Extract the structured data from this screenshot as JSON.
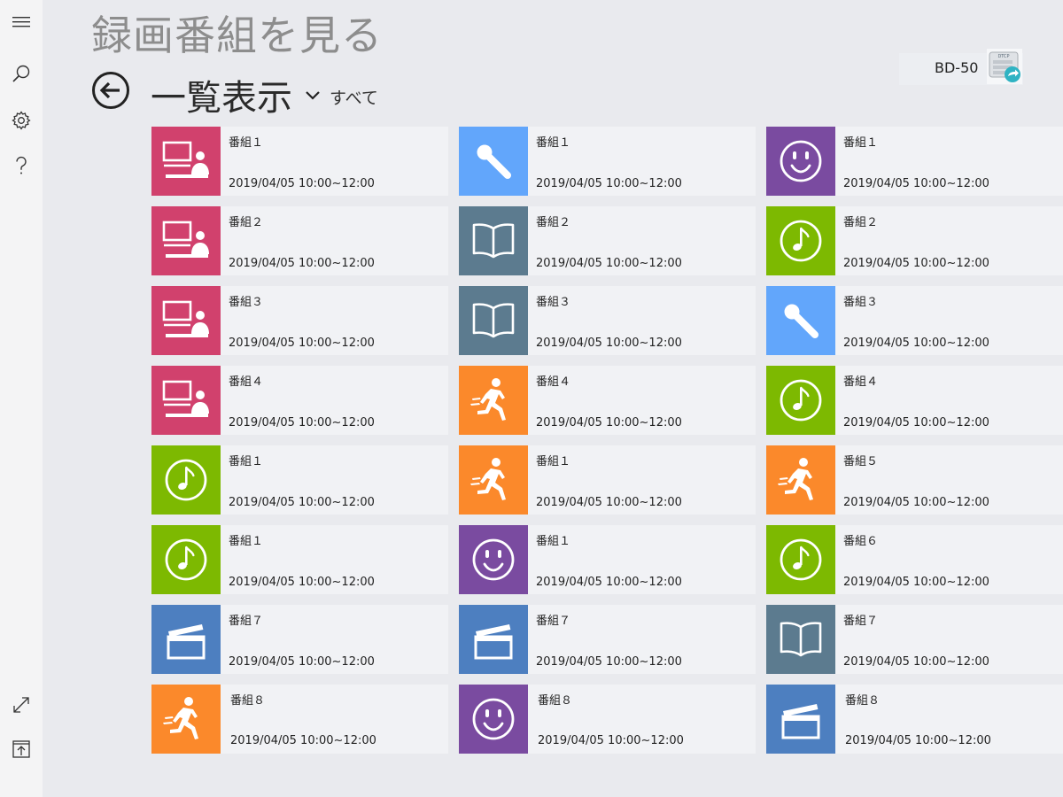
{
  "app": {
    "title": "録画番組を見る",
    "view_title": "一覧表示",
    "filter_label": "すべて"
  },
  "sidebar": {
    "icons": [
      "hamburger-menu-icon",
      "search-icon",
      "gear-icon",
      "help-icon",
      "expand-icon",
      "export-icon"
    ]
  },
  "device": {
    "name": "BD-50",
    "icon": "dtcp-device-icon"
  },
  "colors": {
    "pink": "#d1416d",
    "lightblue": "#62a6fb",
    "purple": "#7a4ba0",
    "slate": "#5c7b8f",
    "green": "#7db901",
    "orange": "#fb892b",
    "blue": "#4d7fc0"
  },
  "recordings": [
    [
      {
        "name": "番組１",
        "datetime": "2019/04/05 10:00~12:00",
        "icon": "presenter-icon",
        "color": "pink"
      },
      {
        "name": "番組２",
        "datetime": "2019/04/05 10:00~12:00",
        "icon": "presenter-icon",
        "color": "pink"
      },
      {
        "name": "番組３",
        "datetime": "2019/04/05 10:00~12:00",
        "icon": "presenter-icon",
        "color": "pink"
      },
      {
        "name": "番組４",
        "datetime": "2019/04/05 10:00~12:00",
        "icon": "presenter-icon",
        "color": "pink"
      },
      {
        "name": "番組１",
        "datetime": "2019/04/05 10:00~12:00",
        "icon": "music-note-icon",
        "color": "green"
      },
      {
        "name": "番組１",
        "datetime": "2019/04/05 10:00~12:00",
        "icon": "music-note-icon",
        "color": "green"
      },
      {
        "name": "番組７",
        "datetime": "2019/04/05 10:00~12:00",
        "icon": "clapperboard-icon",
        "color": "blue"
      },
      {
        "name": "番組８",
        "datetime": "2019/04/05 10:00~12:00",
        "icon": "runner-icon",
        "color": "orange"
      }
    ],
    [
      {
        "name": "番組１",
        "datetime": "2019/04/05 10:00~12:00",
        "icon": "microphone-icon",
        "color": "lightblue"
      },
      {
        "name": "番組２",
        "datetime": "2019/04/05 10:00~12:00",
        "icon": "book-icon",
        "color": "slate"
      },
      {
        "name": "番組３",
        "datetime": "2019/04/05 10:00~12:00",
        "icon": "book-icon",
        "color": "slate"
      },
      {
        "name": "番組４",
        "datetime": "2019/04/05 10:00~12:00",
        "icon": "runner-icon",
        "color": "orange"
      },
      {
        "name": "番組１",
        "datetime": "2019/04/05 10:00~12:00",
        "icon": "runner-icon",
        "color": "orange"
      },
      {
        "name": "番組１",
        "datetime": "2019/04/05 10:00~12:00",
        "icon": "smiley-icon",
        "color": "purple"
      },
      {
        "name": "番組７",
        "datetime": "2019/04/05 10:00~12:00",
        "icon": "clapperboard-icon",
        "color": "blue"
      },
      {
        "name": "番組８",
        "datetime": "2019/04/05 10:00~12:00",
        "icon": "smiley-icon",
        "color": "purple"
      }
    ],
    [
      {
        "name": "番組１",
        "datetime": "2019/04/05 10:00~12:00",
        "icon": "smiley-icon",
        "color": "purple"
      },
      {
        "name": "番組２",
        "datetime": "2019/04/05 10:00~12:00",
        "icon": "music-note-icon",
        "color": "green"
      },
      {
        "name": "番組３",
        "datetime": "2019/04/05 10:00~12:00",
        "icon": "microphone-icon",
        "color": "lightblue"
      },
      {
        "name": "番組４",
        "datetime": "2019/04/05 10:00~12:00",
        "icon": "music-note-icon",
        "color": "green"
      },
      {
        "name": "番組５",
        "datetime": "2019/04/05 10:00~12:00",
        "icon": "runner-icon",
        "color": "orange"
      },
      {
        "name": "番組６",
        "datetime": "2019/04/05 10:00~12:00",
        "icon": "music-note-icon",
        "color": "green"
      },
      {
        "name": "番組７",
        "datetime": "2019/04/05 10:00~12:00",
        "icon": "book-icon",
        "color": "slate"
      },
      {
        "name": "番組８",
        "datetime": "2019/04/05 10:00~12:00",
        "icon": "clapperboard-icon",
        "color": "blue"
      }
    ]
  ]
}
